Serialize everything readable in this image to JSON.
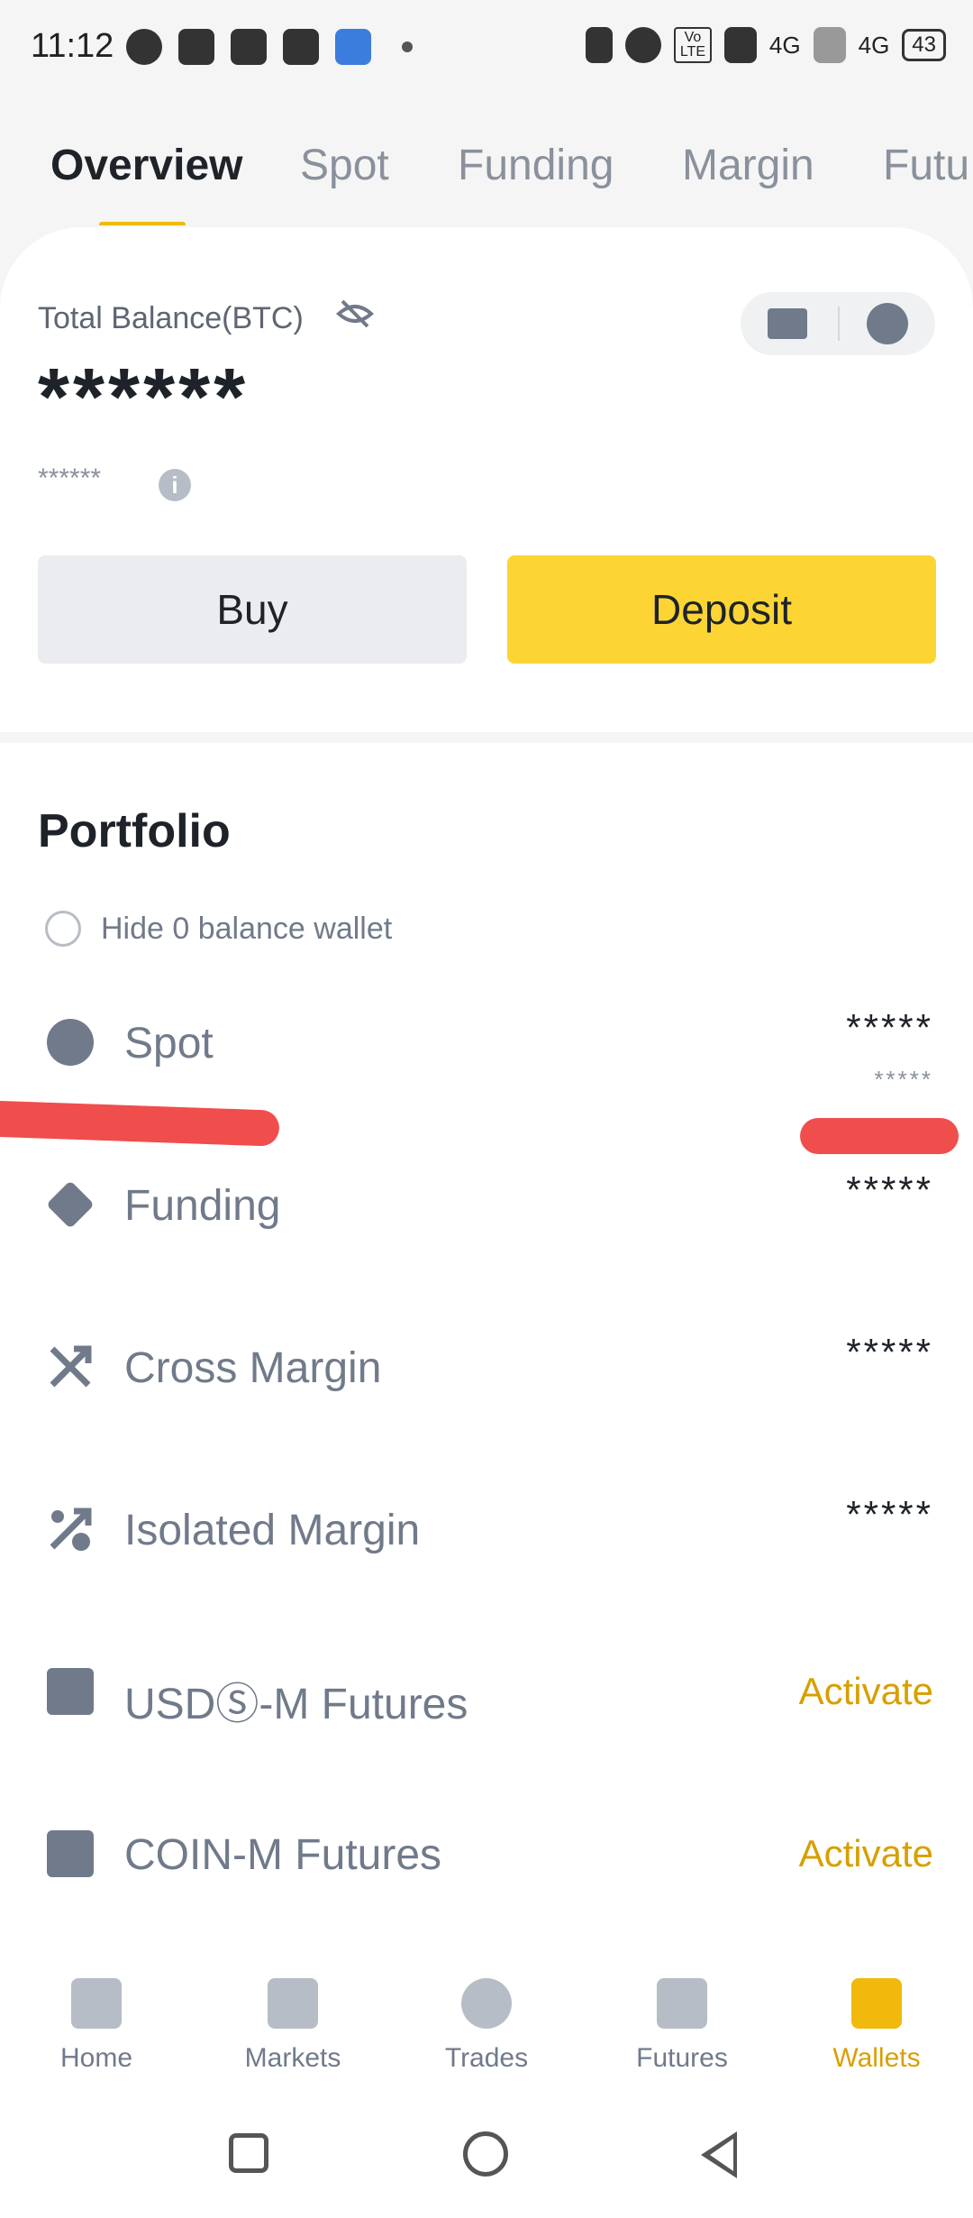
{
  "status_bar": {
    "time": "11:12",
    "network_1": "4G",
    "network_2": "4G",
    "battery": "43",
    "volte": "Vo LTE"
  },
  "tabs": [
    {
      "label": "Overview",
      "active": true
    },
    {
      "label": "Spot"
    },
    {
      "label": "Funding"
    },
    {
      "label": "Margin"
    },
    {
      "label": "Futu"
    }
  ],
  "balance": {
    "label": "Total Balance(BTC)",
    "value": "******",
    "sub_value": "******"
  },
  "actions": {
    "buy": "Buy",
    "deposit": "Deposit"
  },
  "portfolio": {
    "title": "Portfolio",
    "hide_zero_label": "Hide 0 balance wallet",
    "items": [
      {
        "name": "Spot",
        "value": "*****",
        "sub": "*****",
        "icon": "spot-icon"
      },
      {
        "name": "Funding",
        "value": "*****",
        "icon": "funding-icon"
      },
      {
        "name": "Cross Margin",
        "value": "*****",
        "icon": "cross-margin-icon"
      },
      {
        "name": "Isolated Margin",
        "value": "*****",
        "icon": "isolated-margin-icon"
      },
      {
        "name": "USDⓈ-M Futures",
        "action": "Activate",
        "icon": "usd-futures-icon"
      },
      {
        "name": "COIN-M Futures",
        "action": "Activate",
        "icon": "coin-futures-icon"
      }
    ]
  },
  "bottom_nav": [
    {
      "label": "Home",
      "icon": "home-icon"
    },
    {
      "label": "Markets",
      "icon": "markets-icon"
    },
    {
      "label": "Trades",
      "icon": "trades-icon"
    },
    {
      "label": "Futures",
      "icon": "futures-icon"
    },
    {
      "label": "Wallets",
      "icon": "wallet-icon",
      "active": true
    }
  ],
  "colors": {
    "accent": "#F0B90B",
    "deposit_button": "#FCD535",
    "activate_text": "#D89F00",
    "annotation_red": "#F04D4D"
  }
}
